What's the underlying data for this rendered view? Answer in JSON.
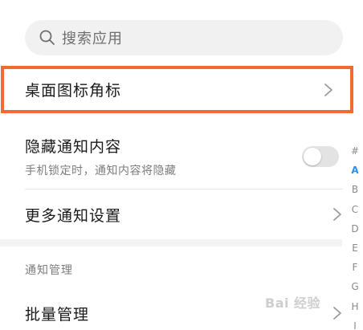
{
  "search": {
    "placeholder": "搜索应用"
  },
  "rows": {
    "badge": {
      "label": "桌面图标角标"
    },
    "hide": {
      "label": "隐藏通知内容",
      "sub": "手机锁定时，通知内容将隐藏",
      "toggle_on": false
    },
    "more": {
      "label": "更多通知设置"
    }
  },
  "section": {
    "title": "通知管理"
  },
  "batch": {
    "label": "批量管理"
  },
  "index_letters": [
    "#",
    "A",
    "B",
    "C",
    "D",
    "E",
    "F",
    "G",
    "H",
    "I"
  ],
  "index_active": "A",
  "watermark": "Bai 经验",
  "colors": {
    "highlight": "#f06a32",
    "index_active": "#2f8fe8"
  }
}
